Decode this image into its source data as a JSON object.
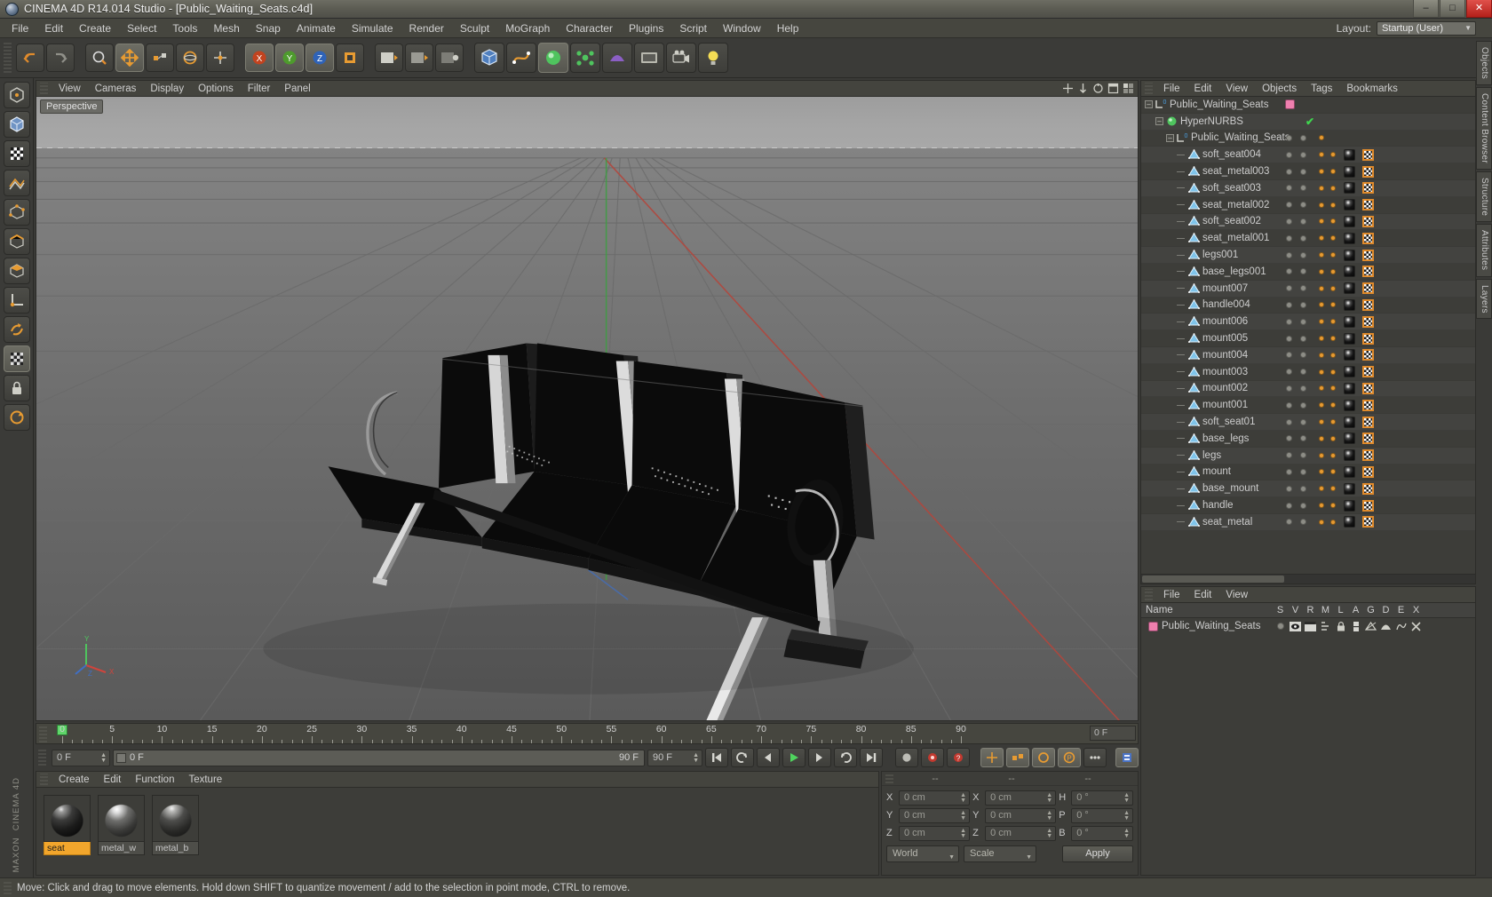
{
  "window": {
    "title": "CINEMA 4D R14.014 Studio - [Public_Waiting_Seats.c4d]",
    "minimize": "–",
    "maximize": "□",
    "close": "✕"
  },
  "menubar": {
    "items": [
      "File",
      "Edit",
      "Create",
      "Select",
      "Tools",
      "Mesh",
      "Snap",
      "Animate",
      "Simulate",
      "Render",
      "Sculpt",
      "MoGraph",
      "Character",
      "Plugins",
      "Script",
      "Window",
      "Help"
    ],
    "layout_label": "Layout:",
    "layout_value": "Startup (User)"
  },
  "viewport": {
    "menu": [
      "View",
      "Cameras",
      "Display",
      "Options",
      "Filter",
      "Panel"
    ],
    "label": "Perspective",
    "axis": {
      "x": "X",
      "y": "Y",
      "z": "Z"
    }
  },
  "timeline": {
    "ticks": [
      0,
      5,
      10,
      15,
      20,
      25,
      30,
      35,
      40,
      45,
      50,
      55,
      60,
      65,
      70,
      75,
      80,
      85,
      90
    ],
    "current_frame_field": "0 F",
    "start_field": "0 F",
    "bar_left": "0 F",
    "bar_right": "90 F",
    "end_field": "90 F"
  },
  "material_manager": {
    "menu": [
      "Create",
      "Edit",
      "Function",
      "Texture"
    ],
    "materials": [
      {
        "name": "seat",
        "selected": true
      },
      {
        "name": "metal_w",
        "selected": false
      },
      {
        "name": "metal_b",
        "selected": false
      }
    ]
  },
  "coordinates": {
    "header": [
      "--",
      "--",
      "--"
    ],
    "rows": [
      {
        "pos_label": "X",
        "pos_value": "0 cm",
        "size_label": "X",
        "size_value": "0 cm",
        "rot_label": "H",
        "rot_value": "0 °"
      },
      {
        "pos_label": "Y",
        "pos_value": "0 cm",
        "size_label": "Y",
        "size_value": "0 cm",
        "rot_label": "P",
        "rot_value": "0 °"
      },
      {
        "pos_label": "Z",
        "pos_value": "0 cm",
        "size_label": "Z",
        "size_value": "0 cm",
        "rot_label": "B",
        "rot_value": "0 °"
      }
    ],
    "coord_system": "World",
    "mode": "Scale",
    "apply": "Apply"
  },
  "object_manager": {
    "menu": [
      "File",
      "Edit",
      "View",
      "Objects",
      "Tags",
      "Bookmarks"
    ],
    "items": [
      {
        "name": "Public_Waiting_Seats",
        "depth": 0,
        "icon": "null-object",
        "expand": "–",
        "tags": "none",
        "color_swatch": "#ef7fae",
        "check": false
      },
      {
        "name": "HyperNURBS",
        "depth": 1,
        "icon": "hypernurbs",
        "expand": "–",
        "tags": "none",
        "check": true
      },
      {
        "name": "Public_Waiting_Seats",
        "depth": 2,
        "icon": "null-object",
        "expand": "–",
        "tags": "dot"
      },
      {
        "name": "soft_seat004",
        "depth": 3,
        "icon": "polygon-object",
        "tags": "full"
      },
      {
        "name": "seat_metal003",
        "depth": 3,
        "icon": "polygon-object",
        "tags": "full"
      },
      {
        "name": "soft_seat003",
        "depth": 3,
        "icon": "polygon-object",
        "tags": "full"
      },
      {
        "name": "seat_metal002",
        "depth": 3,
        "icon": "polygon-object",
        "tags": "full"
      },
      {
        "name": "soft_seat002",
        "depth": 3,
        "icon": "polygon-object",
        "tags": "full"
      },
      {
        "name": "seat_metal001",
        "depth": 3,
        "icon": "polygon-object",
        "tags": "full"
      },
      {
        "name": "legs001",
        "depth": 3,
        "icon": "polygon-object",
        "tags": "full"
      },
      {
        "name": "base_legs001",
        "depth": 3,
        "icon": "polygon-object",
        "tags": "full"
      },
      {
        "name": "mount007",
        "depth": 3,
        "icon": "polygon-object",
        "tags": "full"
      },
      {
        "name": "handle004",
        "depth": 3,
        "icon": "polygon-object",
        "tags": "full"
      },
      {
        "name": "mount006",
        "depth": 3,
        "icon": "polygon-object",
        "tags": "full"
      },
      {
        "name": "mount005",
        "depth": 3,
        "icon": "polygon-object",
        "tags": "full"
      },
      {
        "name": "mount004",
        "depth": 3,
        "icon": "polygon-object",
        "tags": "full"
      },
      {
        "name": "mount003",
        "depth": 3,
        "icon": "polygon-object",
        "tags": "full"
      },
      {
        "name": "mount002",
        "depth": 3,
        "icon": "polygon-object",
        "tags": "full"
      },
      {
        "name": "mount001",
        "depth": 3,
        "icon": "polygon-object",
        "tags": "full"
      },
      {
        "name": "soft_seat01",
        "depth": 3,
        "icon": "polygon-object",
        "tags": "full"
      },
      {
        "name": "base_legs",
        "depth": 3,
        "icon": "polygon-object",
        "tags": "full"
      },
      {
        "name": "legs",
        "depth": 3,
        "icon": "polygon-object",
        "tags": "full"
      },
      {
        "name": "mount",
        "depth": 3,
        "icon": "polygon-object",
        "tags": "full"
      },
      {
        "name": "base_mount",
        "depth": 3,
        "icon": "polygon-object",
        "tags": "full"
      },
      {
        "name": "handle",
        "depth": 3,
        "icon": "polygon-object",
        "tags": "full"
      },
      {
        "name": "seat_metal",
        "depth": 3,
        "icon": "polygon-object",
        "tags": "full"
      }
    ]
  },
  "layer_manager": {
    "menu": [
      "File",
      "Edit",
      "View"
    ],
    "columns": [
      "Name",
      "S",
      "V",
      "R",
      "M",
      "L",
      "A",
      "G",
      "D",
      "E",
      "X"
    ],
    "rows": [
      {
        "name": "Public_Waiting_Seats",
        "color": "#ef7fae"
      }
    ]
  },
  "right_tabs": [
    "Objects",
    "Content Browser",
    "Structure",
    "Attributes",
    "Layers"
  ],
  "statusbar": {
    "text": "Move: Click and drag to move elements. Hold down SHIFT to quantize movement / add to the selection in point mode, CTRL to remove."
  },
  "colors": {
    "accent_orange": "#e79b32",
    "selection_orange": "#f2a62c",
    "green_axis": "#3fd44e",
    "red_axis": "#d0443c",
    "layer_pink": "#ef7fae"
  }
}
